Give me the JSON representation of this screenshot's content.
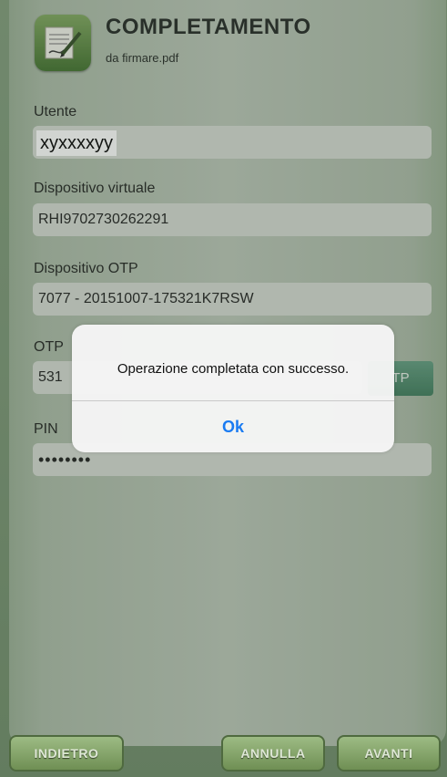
{
  "header": {
    "title": "COMPLETAMENTO",
    "subtitle": "da firmare.pdf"
  },
  "form": {
    "utente_label": "Utente",
    "utente_value": "xyxxxxyy",
    "dispositivo_virtuale_label": "Dispositivo virtuale",
    "dispositivo_virtuale_value": "RHI9702730262291",
    "dispositivo_otp_label": "Dispositivo OTP",
    "dispositivo_otp_value": "7077 - 20151007-175321K7RSW",
    "otp_label": "OTP",
    "otp_value": "531",
    "otp_button_label": "TP",
    "pin_label": "PIN",
    "pin_value": "••••••••"
  },
  "alert": {
    "message": "Operazione completata con successo.",
    "ok_label": "Ok"
  },
  "footer": {
    "back_label": "INDIETRO",
    "cancel_label": "ANNULLA",
    "next_label": "AVANTI"
  }
}
